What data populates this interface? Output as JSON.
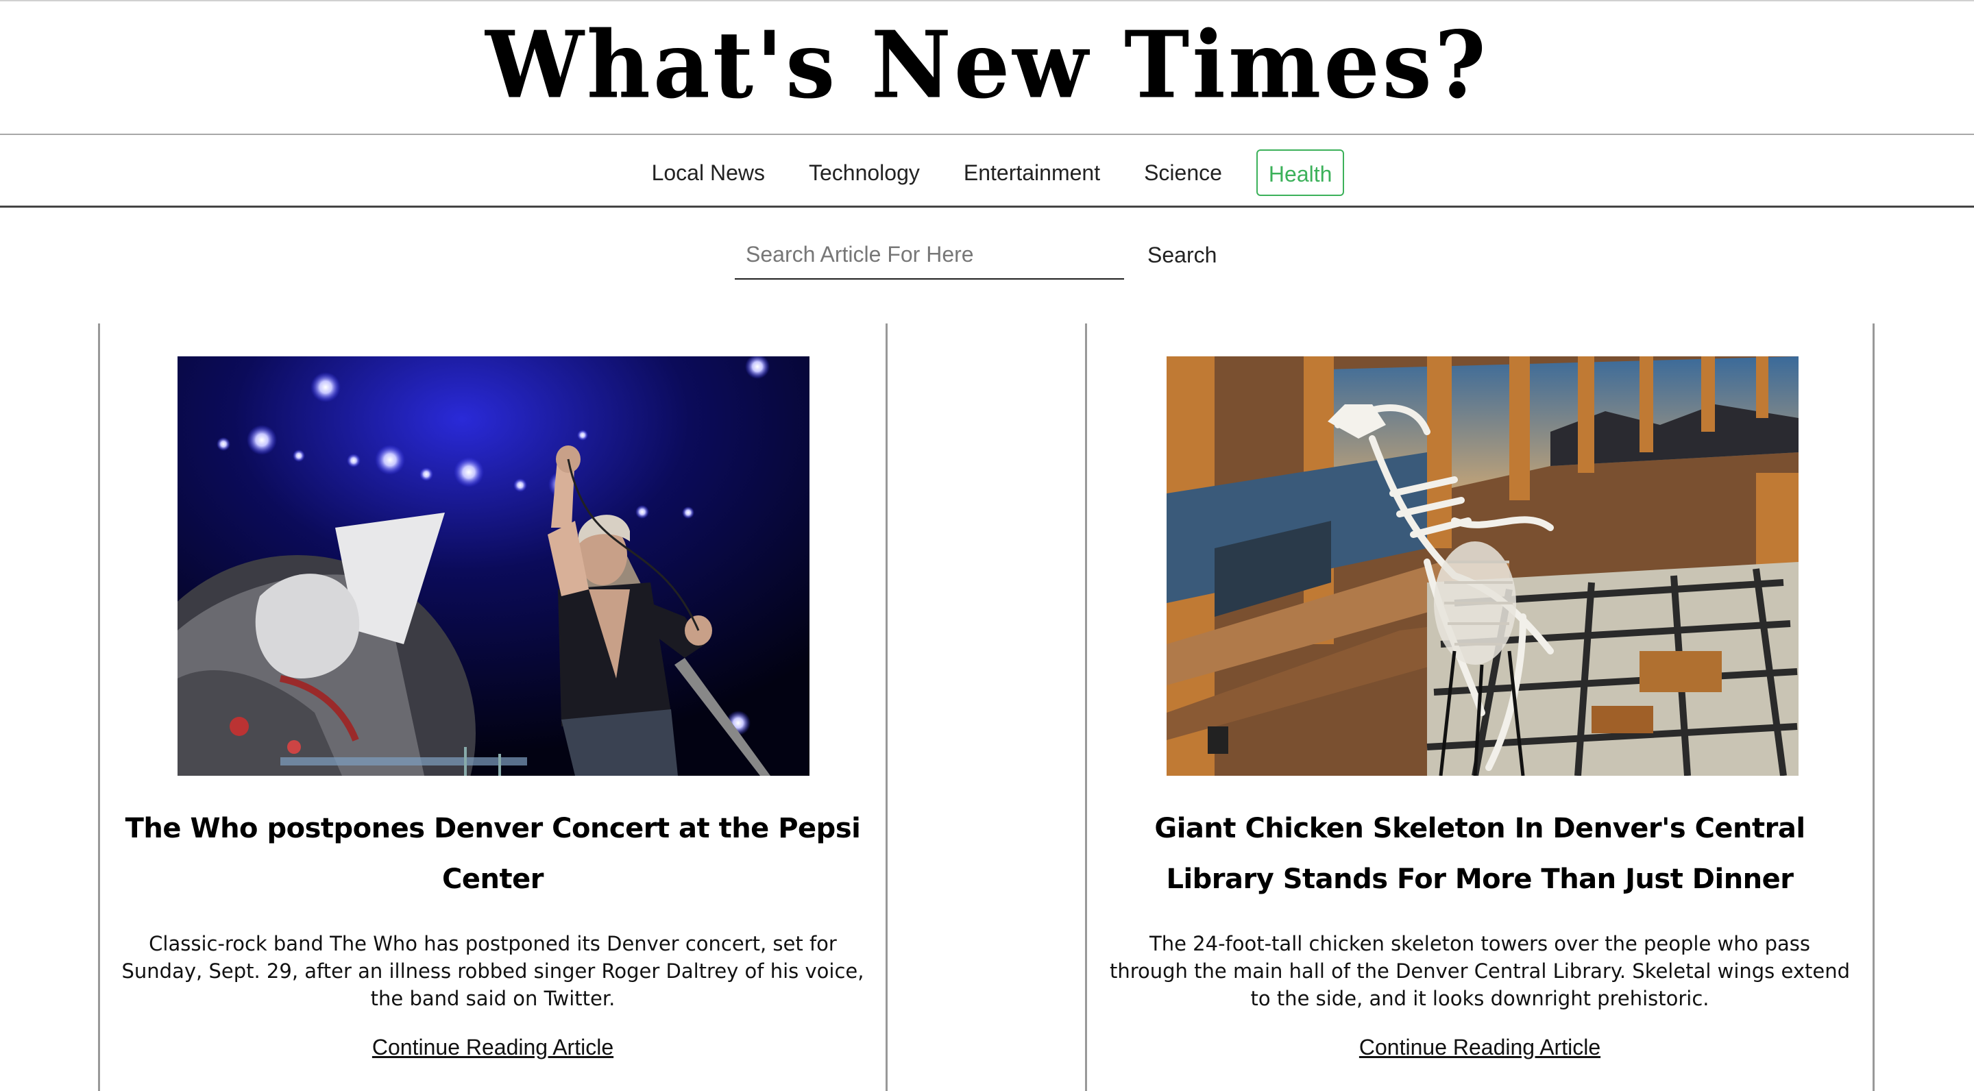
{
  "masthead": {
    "title": "What's New Times?"
  },
  "nav": {
    "items": [
      {
        "label": "Local News"
      },
      {
        "label": "Technology"
      },
      {
        "label": "Entertainment"
      },
      {
        "label": "Science"
      },
      {
        "label": "Health"
      }
    ],
    "active": "Health",
    "active_color": "#3cb15a"
  },
  "search": {
    "placeholder": "Search Article For Here",
    "value": "",
    "button_label": "Search"
  },
  "articles": [
    {
      "image_alt": "Roger Daltrey performing on stage with microphone",
      "title": "The Who postpones Denver Concert at the Pepsi Center",
      "summary": "Classic-rock band The Who has postponed its Denver concert, set for Sunday, Sept. 29, after an illness robbed singer Roger Daltrey of his voice, the band said on Twitter.",
      "link_label": "Continue Reading Article"
    },
    {
      "image_alt": "Giant chicken skeleton in the Denver Central Library hall",
      "title": "Giant Chicken Skeleton In Denver's Central Library Stands For More Than Just Dinner",
      "summary": "The 24-foot-tall chicken skeleton towers over the people who pass through the main hall of the Denver Central Library. Skeletal wings extend to the side, and it looks downright prehistoric.",
      "link_label": "Continue Reading Article"
    }
  ]
}
